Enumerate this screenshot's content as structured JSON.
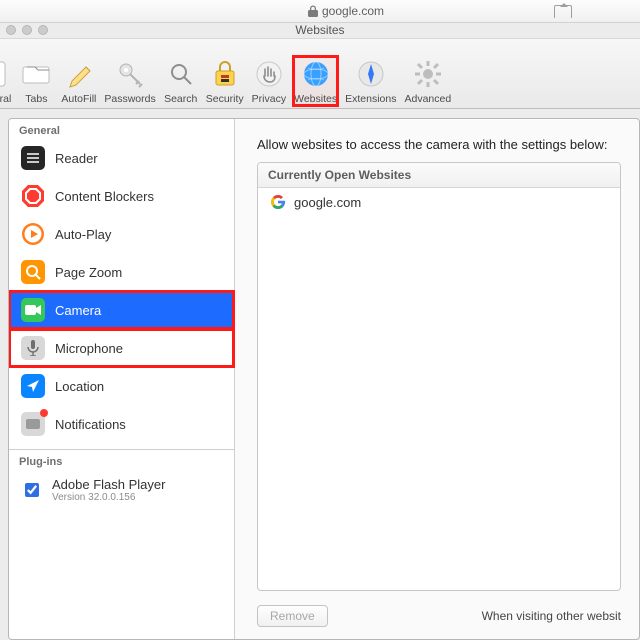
{
  "address": {
    "lock": true,
    "url": "google.com"
  },
  "window_title": "Websites",
  "toolbar": [
    {
      "key": "general",
      "label": "General"
    },
    {
      "key": "tabs",
      "label": "Tabs"
    },
    {
      "key": "autofill",
      "label": "AutoFill"
    },
    {
      "key": "passwords",
      "label": "Passwords"
    },
    {
      "key": "search",
      "label": "Search"
    },
    {
      "key": "security",
      "label": "Security"
    },
    {
      "key": "privacy",
      "label": "Privacy"
    },
    {
      "key": "websites",
      "label": "Websites",
      "selected": true,
      "highlighted": true
    },
    {
      "key": "extensions",
      "label": "Extensions"
    },
    {
      "key": "advanced",
      "label": "Advanced"
    }
  ],
  "sidebar": {
    "groups": [
      {
        "title": "General",
        "items": [
          {
            "key": "reader",
            "label": "Reader"
          },
          {
            "key": "content-blockers",
            "label": "Content Blockers"
          },
          {
            "key": "auto-play",
            "label": "Auto-Play"
          },
          {
            "key": "page-zoom",
            "label": "Page Zoom"
          },
          {
            "key": "camera",
            "label": "Camera",
            "selected": true,
            "highlighted": true
          },
          {
            "key": "microphone",
            "label": "Microphone",
            "highlighted": true
          },
          {
            "key": "location",
            "label": "Location"
          },
          {
            "key": "notifications",
            "label": "Notifications",
            "badge": true
          }
        ]
      },
      {
        "title": "Plug-ins",
        "items": [
          {
            "key": "flash",
            "label": "Adobe Flash Player",
            "subtitle": "Version 32.0.0.156",
            "checkbox": true,
            "checked": true
          }
        ]
      }
    ]
  },
  "main": {
    "description": "Allow websites to access the camera with the settings below:",
    "list_header": "Currently Open Websites",
    "rows": [
      {
        "favicon": "google",
        "host": "google.com"
      }
    ],
    "remove_label": "Remove",
    "footer_hint": "When visiting other websit"
  }
}
